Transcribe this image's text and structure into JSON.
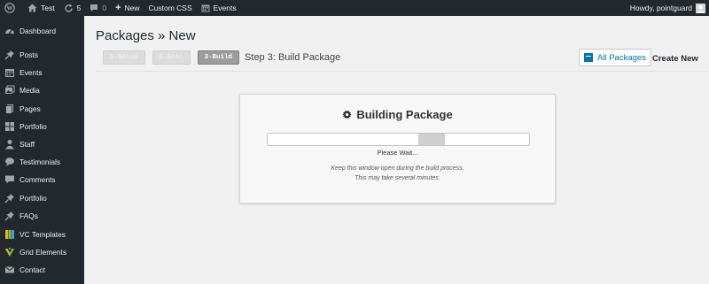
{
  "adminbar": {
    "site_name": "Test",
    "updates_count": "5",
    "comments_count": "0",
    "new_label": "New",
    "custom_css_label": "Custom CSS",
    "events_label": "Events",
    "howdy_text": "Howdy, pointguard"
  },
  "sidebar": {
    "items": [
      {
        "label": "Dashboard",
        "icon": "dashboard-icon"
      },
      {
        "label": "Posts",
        "icon": "pin-icon"
      },
      {
        "label": "Events",
        "icon": "calendar-icon"
      },
      {
        "label": "Media",
        "icon": "media-icon"
      },
      {
        "label": "Pages",
        "icon": "pages-icon"
      },
      {
        "label": "Portfolio",
        "icon": "portfolio-icon"
      },
      {
        "label": "Staff",
        "icon": "staff-icon"
      },
      {
        "label": "Testimonials",
        "icon": "testimonials-icon"
      },
      {
        "label": "Comments",
        "icon": "comments-icon"
      },
      {
        "label": "Portfolio",
        "icon": "pin-icon"
      },
      {
        "label": "FAQs",
        "icon": "pin-icon"
      },
      {
        "label": "VC Templates",
        "icon": "vc-templates-icon"
      },
      {
        "label": "Grid Elements",
        "icon": "grid-elements-icon"
      },
      {
        "label": "Contact",
        "icon": "mail-icon"
      }
    ]
  },
  "page": {
    "title": "Packages » New",
    "steps": [
      "1-Setup",
      "2-Scan",
      "3-Build"
    ],
    "step_title": "Step 3: Build Package",
    "all_packages_label": "All Packages",
    "create_new_label": "Create New"
  },
  "build": {
    "title": "Building Package",
    "wait_text": "Please Wait...",
    "note_line1": "Keep this window open during the build process.",
    "note_line2": "This may take several minutes."
  },
  "colors": {
    "sidebar_bg": "#23282d",
    "link_blue": "#0073aa",
    "page_bg": "#f1f1f1"
  }
}
